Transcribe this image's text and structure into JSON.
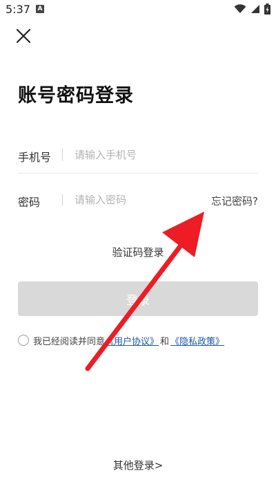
{
  "status_bar": {
    "time": "5:37",
    "notification_glyph": "A",
    "icons": [
      "wifi-icon",
      "signal-icon",
      "battery-charging-icon"
    ]
  },
  "header": {
    "close_icon": "close-icon"
  },
  "page": {
    "title": "账号密码登录"
  },
  "form": {
    "phone": {
      "label": "手机号",
      "placeholder": "请输入手机号",
      "value": ""
    },
    "password": {
      "label": "密码",
      "placeholder": "请输入密码",
      "value": ""
    },
    "forgot_label": "忘记密码?"
  },
  "sms_login_label": "验证码登录",
  "login_button_label": "登录",
  "agreement": {
    "prefix": "我已经阅读并同意",
    "user_agreement": "《用户协议》",
    "and": "和",
    "privacy_policy": "《隐私政策》",
    "checked": false
  },
  "other_login_label": "其他登录>",
  "colors": {
    "link": "#1a58b0",
    "login_button_disabled": "#d9d9d9",
    "annotation_arrow": "#ee1c25"
  }
}
